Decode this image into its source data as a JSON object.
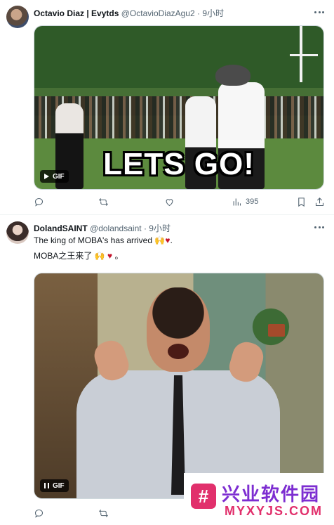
{
  "tweets": [
    {
      "display_name": "Octavio Diaz | Evytds",
      "handle": "@OctavioDiazAgu2",
      "separator": "·",
      "time": "9小时",
      "media": {
        "overlay_text": "LETS GO!",
        "badge": "GIF",
        "badge_state": "play"
      },
      "actions": {
        "views": "395"
      }
    },
    {
      "display_name": "DolandSAINT",
      "handle": "@dolandsaint",
      "separator": "·",
      "time": "9小时",
      "text_line1": "The king of MOBA's has arrived",
      "text_line1_emoji": "🙌",
      "text_line1_end": ".",
      "text_line2": "MOBA之王来了",
      "text_line2_emoji": "🙌",
      "text_line2_end": "。",
      "heart_glyph": "♥",
      "media": {
        "badge": "GIF",
        "badge_state": "pause"
      }
    }
  ],
  "watermark": {
    "logo_glyph": "#",
    "title": "兴业软件园",
    "url": "MYXYJS.COM"
  },
  "colors": {
    "accent_heart": "#c4142c",
    "muted_text": "#536471",
    "watermark_purple": "#7d2ed1",
    "watermark_pink": "#e1306c"
  }
}
